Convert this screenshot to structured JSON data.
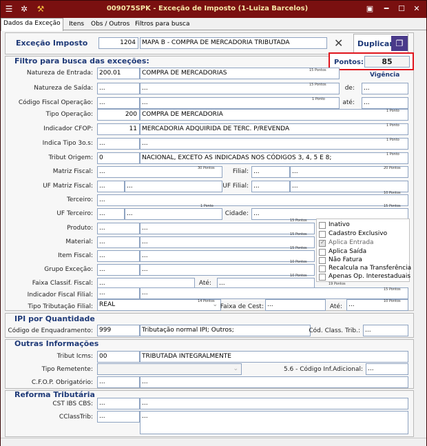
{
  "window": {
    "title": "009075SPK - Exceção de Imposto (1-Luiza Barcelos)"
  },
  "tabs": [
    "Dados da Exceção",
    "Itens",
    "Obs / Outros",
    "Filtros para busca"
  ],
  "header": {
    "label": "Exceção Imposto",
    "code": "1204",
    "description": "MAPA B - COMPRA DE MERCADORIA TRIBUTADA",
    "duplicate_label": "Duplicar",
    "points_label": "Pontos:",
    "points_value": "85"
  },
  "filter": {
    "title": "Filtro para busca das exceções:",
    "vigencia_label": "Vigência",
    "de_label": "de:",
    "de_value": "...",
    "ate_label": "até:",
    "ate_value": "...",
    "natureza_entrada": {
      "label": "Natureza de Entrada:",
      "code": "200.01",
      "desc": "COMPRA DE MERCADORIAS",
      "pts": "15 Pontos"
    },
    "natureza_saida": {
      "label": "Natureza de Saída:",
      "code": "...",
      "desc": "...",
      "pts": "15 Pontos"
    },
    "cfop": {
      "label": "Código Fiscal Operação:",
      "code": "...",
      "desc": "...",
      "pts": "1 Ponto"
    },
    "tipo_operacao": {
      "label": "Tipo Operação:",
      "code": "200",
      "desc": "COMPRA DE MERCADORIA",
      "pts": "1 Ponto"
    },
    "indicador_cfop": {
      "label": "Indicador CFOP:",
      "code": "11",
      "desc": "MERCADORIA ADQUIRIDA DE TERC. P/REVENDA",
      "pts": "1 Ponto"
    },
    "indica_tipo": {
      "label": "Indica Tipo 3o.s:",
      "code": "...",
      "desc": "...",
      "pts": "1 Ponto"
    },
    "tribut_origem": {
      "label": "Tribut Origem:",
      "code": "0",
      "desc": "NACIONAL, EXCETO AS INDICADAS NOS CÓDIGOS 3, 4, 5 E 8;",
      "pts": "1 Ponto"
    },
    "matriz_fiscal": {
      "label": "Matriz Fiscal:",
      "code": "...",
      "pts": "30 Pontos"
    },
    "filial": {
      "label": "Filial:",
      "code": "...",
      "desc": "...",
      "pts": "20 Pontos"
    },
    "uf_matriz": {
      "label": "UF Matriz Fiscal:",
      "code": "...",
      "desc": "..."
    },
    "uf_filial": {
      "label": "UF Filial:",
      "code": "...",
      "desc": "...",
      "pts": "10 Pontos"
    },
    "terceiro": {
      "label": "Terceiro:",
      "code": "...",
      "pts": "1 Ponto"
    },
    "uf_terceiro": {
      "label": "UF Terceiro:",
      "code": "...",
      "desc": "..."
    },
    "cidade": {
      "label": "Cidade:",
      "code": "...",
      "pts": "15 Pontos"
    },
    "produto": {
      "label": "Produto:",
      "code": "...",
      "desc": "...",
      "pts": "15 Pontos"
    },
    "material": {
      "label": "Material:",
      "code": "...",
      "desc": "...",
      "pts": "15 Pontos"
    },
    "item_fiscal": {
      "label": "Item Fiscal:",
      "code": "...",
      "desc": "...",
      "pts": "15 Pontos"
    },
    "grupo_excecao": {
      "label": "Grupo Exceção:",
      "code": "...",
      "desc": "...",
      "pts": "10 Pontos"
    },
    "faixa_classif": {
      "label": "Faixa Classif. Fiscal:",
      "code": "...",
      "ate_label": "Até:",
      "ate_value": "...",
      "pts": "10 Pontos"
    },
    "indicador_fiscal_filial": {
      "label": "Indicador Fiscal Filial:",
      "code": "...",
      "desc": "...",
      "pts": "15 Pontos"
    },
    "tipo_tributacao_filial": {
      "label": "Tipo Tributação Filial:",
      "value": "REAL",
      "pts": "14 Pontos"
    },
    "faixa_cest": {
      "label": "Faixa de Cest:",
      "value": "...",
      "ate_label": "Até:",
      "ate_value": "...",
      "pts": "10 Pontos"
    },
    "checkboxes": [
      {
        "label": "Inativo",
        "checked": false,
        "disabled": false
      },
      {
        "label": "Cadastro Exclusivo",
        "checked": false,
        "disabled": false
      },
      {
        "label": "Aplica Entrada",
        "checked": true,
        "disabled": true
      },
      {
        "label": "Aplica Saída",
        "checked": false,
        "disabled": false
      },
      {
        "label": "Não Fatura",
        "checked": false,
        "disabled": false
      },
      {
        "label": "Recalcula na Transferência",
        "checked": false,
        "disabled": false
      },
      {
        "label": "Apenas Op. Interestaduais",
        "checked": false,
        "disabled": false
      }
    ],
    "cb_pts": "19 Pontos"
  },
  "ipi": {
    "title": "IPI por Quantidade",
    "label": "Código de Enquadramento:",
    "code": "999",
    "desc": "Tributação normal IPI; Outros;",
    "cclass_label": "Cód. Class. Trib.:",
    "cclass_value": "..."
  },
  "outras": {
    "title": "Outras Informações",
    "tribut_icms": {
      "label": "Tribut Icms:",
      "code": "00",
      "desc": "TRIBUTADA INTEGRALMENTE"
    },
    "tipo_remetente": {
      "label": "Tipo Remetente:",
      "value": ""
    },
    "cod_inf_adicional": {
      "label": "5.6 - Código Inf.Adicional:",
      "value": "..."
    },
    "cfop_obrigatorio": {
      "label": "C.F.O.P. Obrigatório:",
      "code": "...",
      "desc": "..."
    }
  },
  "reforma": {
    "title": "Reforma Tributária",
    "cst_ibs": {
      "label": "CST IBS CBS:",
      "code": "...",
      "desc": "..."
    },
    "cclasstrib": {
      "label": "CClassTrib:",
      "code": "...",
      "desc": "..."
    }
  }
}
